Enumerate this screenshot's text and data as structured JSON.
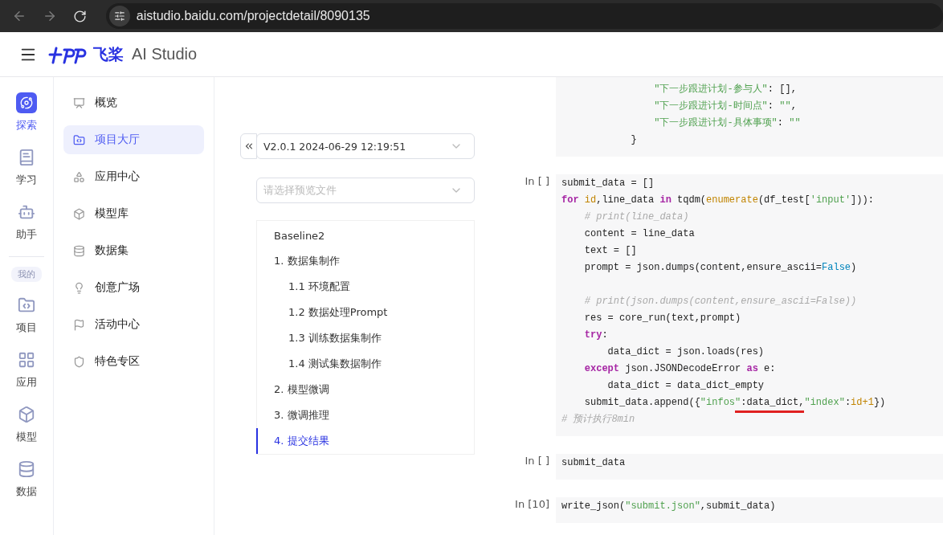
{
  "browser": {
    "url": "aistudio.baidu.com/projectdetail/8090135"
  },
  "header": {
    "logo_text": "飞桨",
    "product": "AI Studio"
  },
  "rail": {
    "items": [
      {
        "label": "探索",
        "selected": true
      },
      {
        "label": "学习",
        "selected": false
      },
      {
        "label": "助手",
        "selected": false
      }
    ],
    "section_badge": "我的",
    "mine_items": [
      {
        "label": "项目",
        "selected": false
      },
      {
        "label": "应用",
        "selected": false
      },
      {
        "label": "模型",
        "selected": false
      },
      {
        "label": "数据",
        "selected": false
      }
    ]
  },
  "nav": {
    "items": [
      {
        "label": "概览",
        "selected": false
      },
      {
        "label": "项目大厅",
        "selected": true
      },
      {
        "label": "应用中心",
        "selected": false
      },
      {
        "label": "模型库",
        "selected": false
      },
      {
        "label": "数据集",
        "selected": false
      },
      {
        "label": "创意广场",
        "selected": false
      },
      {
        "label": "活动中心",
        "selected": false
      },
      {
        "label": "特色专区",
        "selected": false
      }
    ]
  },
  "outline_panel": {
    "version": "V2.0.1 2024-06-29 12:19:51",
    "file_select": {
      "placeholder": "请选择预览文件"
    },
    "toc": [
      {
        "label": "Baseline2",
        "selected": false
      },
      {
        "label": "1. 数据集制作",
        "selected": false,
        "children": [
          {
            "label": "1.1 环境配置",
            "selected": false
          },
          {
            "label": "1.2 数据处理Prompt",
            "selected": false
          },
          {
            "label": "1.3 训练数据集制作",
            "selected": false
          },
          {
            "label": "1.4 测试集数据制作",
            "selected": false
          }
        ]
      },
      {
        "label": "2. 模型微调",
        "selected": false
      },
      {
        "label": "3. 微调推理",
        "selected": false
      },
      {
        "label": "4. 提交结果",
        "selected": true
      }
    ]
  },
  "cells": [
    {
      "lines": [
        {
          "kind": "code",
          "tokens": [
            {
              "kind": "str",
              "text": "                \"下一步跟进计划-参与人\""
            },
            {
              "kind": "plain",
              "text": ": [],"
            }
          ]
        },
        {
          "kind": "code",
          "tokens": [
            {
              "kind": "str",
              "text": "                \"下一步跟进计划-时间点\""
            },
            {
              "kind": "plain",
              "text": ": "
            },
            {
              "kind": "str",
              "text": "\"\""
            },
            {
              "kind": "plain",
              "text": ","
            }
          ]
        },
        {
          "kind": "code",
          "tokens": [
            {
              "kind": "str",
              "text": "                \"下一步跟进计划-具体事项\""
            },
            {
              "kind": "plain",
              "text": ": "
            },
            {
              "kind": "str",
              "text": "\"\""
            }
          ]
        },
        {
          "kind": "code",
          "tokens": [
            {
              "kind": "plain",
              "text": "            }"
            }
          ]
        }
      ]
    },
    {
      "prompt": "In [ ]",
      "lines": [
        {
          "kind": "code",
          "tokens": [
            {
              "kind": "plain",
              "text": "submit_data = []"
            }
          ]
        },
        {
          "kind": "code",
          "tokens": [
            {
              "kind": "kw",
              "text": "for"
            },
            {
              "kind": "builtin",
              "text": " id"
            },
            {
              "kind": "plain",
              "text": ",line_data "
            },
            {
              "kind": "kw",
              "text": "in"
            },
            {
              "kind": "plain",
              "text": " tqdm("
            },
            {
              "kind": "builtin",
              "text": "enumerate"
            },
            {
              "kind": "plain",
              "text": "(df_test["
            },
            {
              "kind": "str",
              "text": "'input'"
            },
            {
              "kind": "plain",
              "text": "])):"
            }
          ]
        },
        {
          "kind": "code",
          "tokens": [
            {
              "kind": "comment",
              "text": "    # print(line_data)"
            }
          ]
        },
        {
          "kind": "code",
          "tokens": [
            {
              "kind": "plain",
              "text": "    content = line_data"
            }
          ]
        },
        {
          "kind": "code",
          "tokens": [
            {
              "kind": "plain",
              "text": "    text = []"
            }
          ]
        },
        {
          "kind": "code",
          "tokens": [
            {
              "kind": "plain",
              "text": "    prompt = json.dumps(content,ensure_ascii="
            },
            {
              "kind": "const",
              "text": "False"
            },
            {
              "kind": "plain",
              "text": ")"
            }
          ]
        },
        {
          "kind": "blank"
        },
        {
          "kind": "code",
          "tokens": [
            {
              "kind": "comment",
              "text": "    # print(json.dumps(content,ensure_ascii=False))"
            }
          ]
        },
        {
          "kind": "code",
          "tokens": [
            {
              "kind": "plain",
              "text": "    res = core_run(text,prompt)"
            }
          ]
        },
        {
          "kind": "code",
          "tokens": [
            {
              "kind": "kw",
              "text": "    try"
            },
            {
              "kind": "plain",
              "text": ":"
            }
          ]
        },
        {
          "kind": "code",
          "tokens": [
            {
              "kind": "plain",
              "text": "        data_dict = json.loads(res)"
            }
          ]
        },
        {
          "kind": "code",
          "tokens": [
            {
              "kind": "kw",
              "text": "    except"
            },
            {
              "kind": "plain",
              "text": " json.JSONDecodeError "
            },
            {
              "kind": "kw",
              "text": "as"
            },
            {
              "kind": "plain",
              "text": " e:"
            }
          ]
        },
        {
          "kind": "code",
          "tokens": [
            {
              "kind": "plain",
              "text": "        data_dict = data_dict_empty"
            }
          ]
        },
        {
          "kind": "code",
          "tokens": [
            {
              "kind": "plain",
              "text": "    submit_data.append({"
            },
            {
              "kind": "str",
              "text": "\"infos\""
            },
            {
              "kind": "mark",
              "text": ":data_dict,"
            },
            {
              "kind": "str",
              "text": "\"index\""
            },
            {
              "kind": "plain",
              "text": ":"
            },
            {
              "kind": "builtin",
              "text": "id+1"
            },
            {
              "kind": "plain",
              "text": "})"
            }
          ]
        },
        {
          "kind": "code",
          "tokens": [
            {
              "kind": "comment",
              "text": "# 预计执行8min"
            }
          ]
        }
      ]
    },
    {
      "prompt": "In [ ]",
      "lines": [
        {
          "kind": "code",
          "tokens": [
            {
              "kind": "plain",
              "text": "submit_data"
            }
          ]
        }
      ]
    },
    {
      "prompt": "In [10]",
      "lines": [
        {
          "kind": "code",
          "tokens": [
            {
              "kind": "plain",
              "text": "write_json("
            },
            {
              "kind": "str",
              "text": "\"submit.json\""
            },
            {
              "kind": "plain",
              "text": ",submit_data)"
            }
          ]
        }
      ]
    }
  ]
}
